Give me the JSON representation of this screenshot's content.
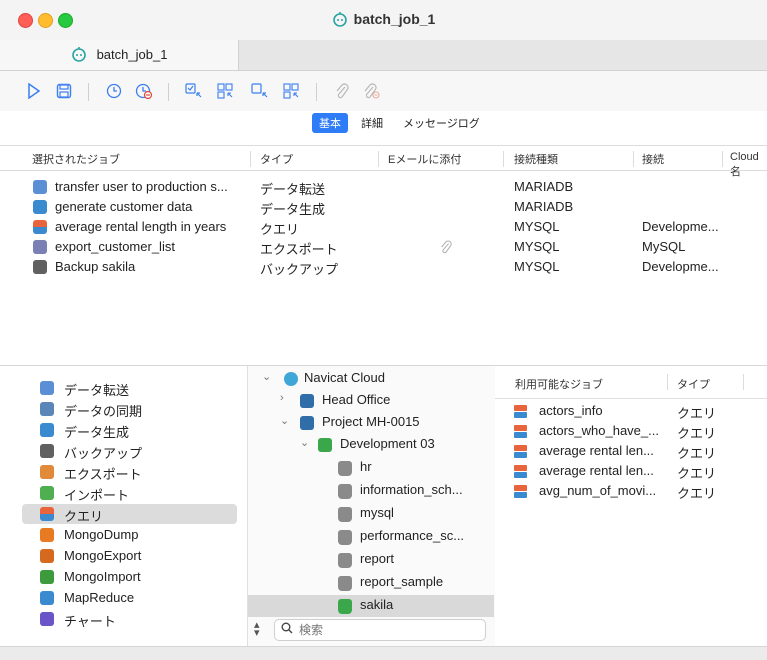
{
  "window": {
    "title": "batch_job_1"
  },
  "tab": {
    "label": "batch_job_1"
  },
  "toolbar": {
    "buttons": [
      "play-icon",
      "save-icon",
      "clock-icon",
      "clock-remove-icon",
      "select-icon",
      "select-all-icon",
      "deselect-icon",
      "deselect-all-icon",
      "attach-icon",
      "detach-icon"
    ]
  },
  "segments": {
    "basic": "基本",
    "detail": "詳細",
    "log": "メッセージログ"
  },
  "jobs": {
    "columns": [
      "選択されたジョブ",
      "タイプ",
      "Eメールに添付",
      "接続種類",
      "接続",
      "Cloud名"
    ],
    "rows": [
      {
        "name": "transfer user to production s...",
        "type": "データ転送",
        "conn_type": "MARIADB",
        "conn": "",
        "icon_color": "#5a8fd6"
      },
      {
        "name": "generate customer data",
        "type": "データ生成",
        "conn_type": "MARIADB",
        "conn": "",
        "icon_color": "#3a8ad0"
      },
      {
        "name": "average rental length in years",
        "type": "クエリ",
        "conn_type": "MYSQL",
        "conn": "Developme...",
        "icon_color": "#e8643c"
      },
      {
        "name": "export_customer_list",
        "type": "エクスポート",
        "conn_type": "MYSQL",
        "conn": "MySQL",
        "icon_color": "#7a7fb4"
      },
      {
        "name": "Backup sakila",
        "type": "バックアップ",
        "conn_type": "MYSQL",
        "conn": "Developme...",
        "icon_color": "#606060"
      }
    ]
  },
  "categories": [
    {
      "label": "データ転送",
      "color": "#5a8fd6"
    },
    {
      "label": "データの同期",
      "color": "#5b86b8"
    },
    {
      "label": "データ生成",
      "color": "#3a8ad0"
    },
    {
      "label": "バックアップ",
      "color": "#606060"
    },
    {
      "label": "エクスポート",
      "color": "#e08a3a"
    },
    {
      "label": "インポート",
      "color": "#4fae4f"
    },
    {
      "label": "クエリ",
      "color": "#e8643c"
    },
    {
      "label": "MongoDump",
      "color": "#e87a22"
    },
    {
      "label": "MongoExport",
      "color": "#d56a1e"
    },
    {
      "label": "MongoImport",
      "color": "#3d9a3d"
    },
    {
      "label": "MapReduce",
      "color": "#3a8ad0"
    },
    {
      "label": "チャート",
      "color": "#6a55c8"
    }
  ],
  "tree": {
    "cloud": "Navicat Cloud",
    "head_office": "Head Office",
    "project": "Project MH-0015",
    "connection": "Development 03",
    "databases": [
      "hr",
      "information_sch...",
      "mysql",
      "performance_sc...",
      "report",
      "report_sample",
      "sakila"
    ]
  },
  "search": {
    "placeholder": "検索"
  },
  "available": {
    "columns": [
      "利用可能なジョブ",
      "タイプ"
    ],
    "items": [
      {
        "name": "actors_info",
        "type": "クエリ"
      },
      {
        "name": "actors_who_have_...",
        "type": "クエリ"
      },
      {
        "name": "average rental len...",
        "type": "クエリ"
      },
      {
        "name": "average rental len...",
        "type": "クエリ"
      },
      {
        "name": "avg_num_of_movi...",
        "type": "クエリ"
      }
    ]
  }
}
